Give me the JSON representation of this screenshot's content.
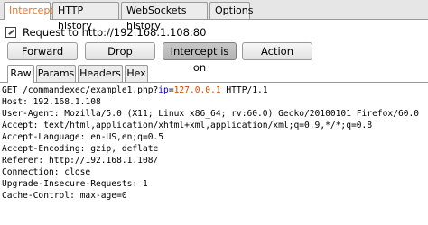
{
  "top_tabs": [
    {
      "label": "Intercept",
      "active": true
    },
    {
      "label": "HTTP history",
      "active": false
    },
    {
      "label": "WebSockets history",
      "active": false
    },
    {
      "label": "Options",
      "active": false
    }
  ],
  "request_header": {
    "text": "Request to http://192.168.1.108:80",
    "icon": "edit-icon"
  },
  "buttons": {
    "forward": "Forward",
    "drop": "Drop",
    "intercept": "Intercept is on",
    "action": "Action"
  },
  "sub_tabs": [
    {
      "label": "Raw",
      "active": true
    },
    {
      "label": "Params",
      "active": false
    },
    {
      "label": "Headers",
      "active": false
    },
    {
      "label": "Hex",
      "active": false
    }
  ],
  "request": {
    "first_line": {
      "prefix": "GET /commandexec/example1.php?",
      "param_name": "ip",
      "equals": "=",
      "param_value": "127.0.0.1",
      "suffix": " HTTP/1.1"
    },
    "lines": [
      "Host: 192.168.1.108",
      "User-Agent: Mozilla/5.0 (X11; Linux x86_64; rv:60.0) Gecko/20100101 Firefox/60.0",
      "Accept: text/html,application/xhtml+xml,application/xml;q=0.9,*/*;q=0.8",
      "Accept-Language: en-US,en;q=0.5",
      "Accept-Encoding: gzip, deflate",
      "Referer: http://192.168.1.108/",
      "Connection: close",
      "Upgrade-Insecure-Requests: 1",
      "Cache-Control: max-age=0"
    ]
  },
  "colors": {
    "active_tab_text": "#e8752a",
    "param_name": "#0000c0",
    "param_value": "#d04a00"
  }
}
